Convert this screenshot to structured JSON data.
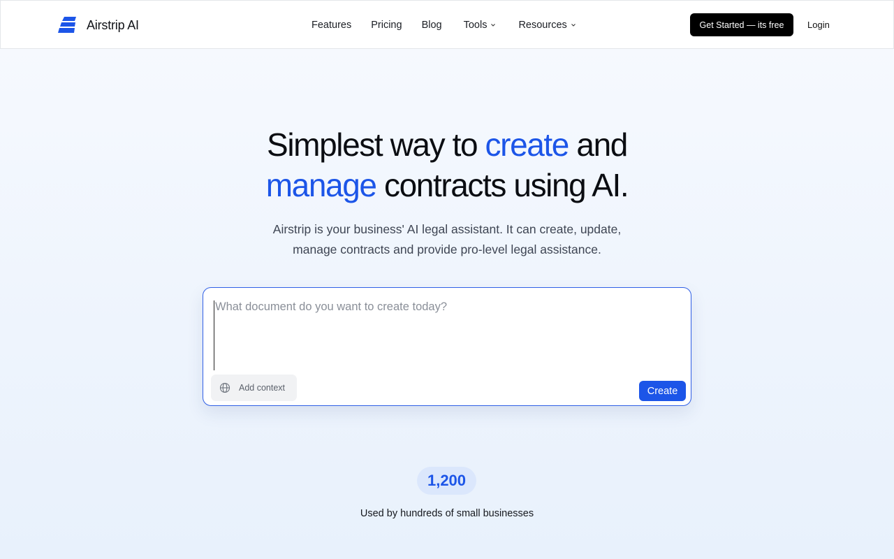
{
  "brand": {
    "name": "Airstrip AI",
    "logo_icon": "airstrip-logo-icon",
    "accent_color": "#1c55e8"
  },
  "nav": {
    "items": [
      {
        "label": "Features",
        "has_dropdown": false
      },
      {
        "label": "Pricing",
        "has_dropdown": false
      },
      {
        "label": "Blog",
        "has_dropdown": false
      },
      {
        "label": "Tools",
        "has_dropdown": true
      },
      {
        "label": "Resources",
        "has_dropdown": true
      }
    ],
    "cta_label": "Get Started — its free",
    "login_label": "Login"
  },
  "hero": {
    "headline_part1": "Simplest way to ",
    "headline_highlight1": "create",
    "headline_part2": " and",
    "headline_highlight2": "manage",
    "headline_part3": " contracts using AI.",
    "subtitle": "Airstrip is your business' AI legal assistant. It can create, update, manage contracts and provide pro-level legal assistance."
  },
  "prompt": {
    "placeholder": "What document do you want to create today?",
    "value": "",
    "add_context_label": "Add context",
    "add_context_icon": "globe-icon",
    "create_label": "Create"
  },
  "stats": {
    "count": "1,200",
    "caption": "Used by hundreds of small businesses"
  }
}
